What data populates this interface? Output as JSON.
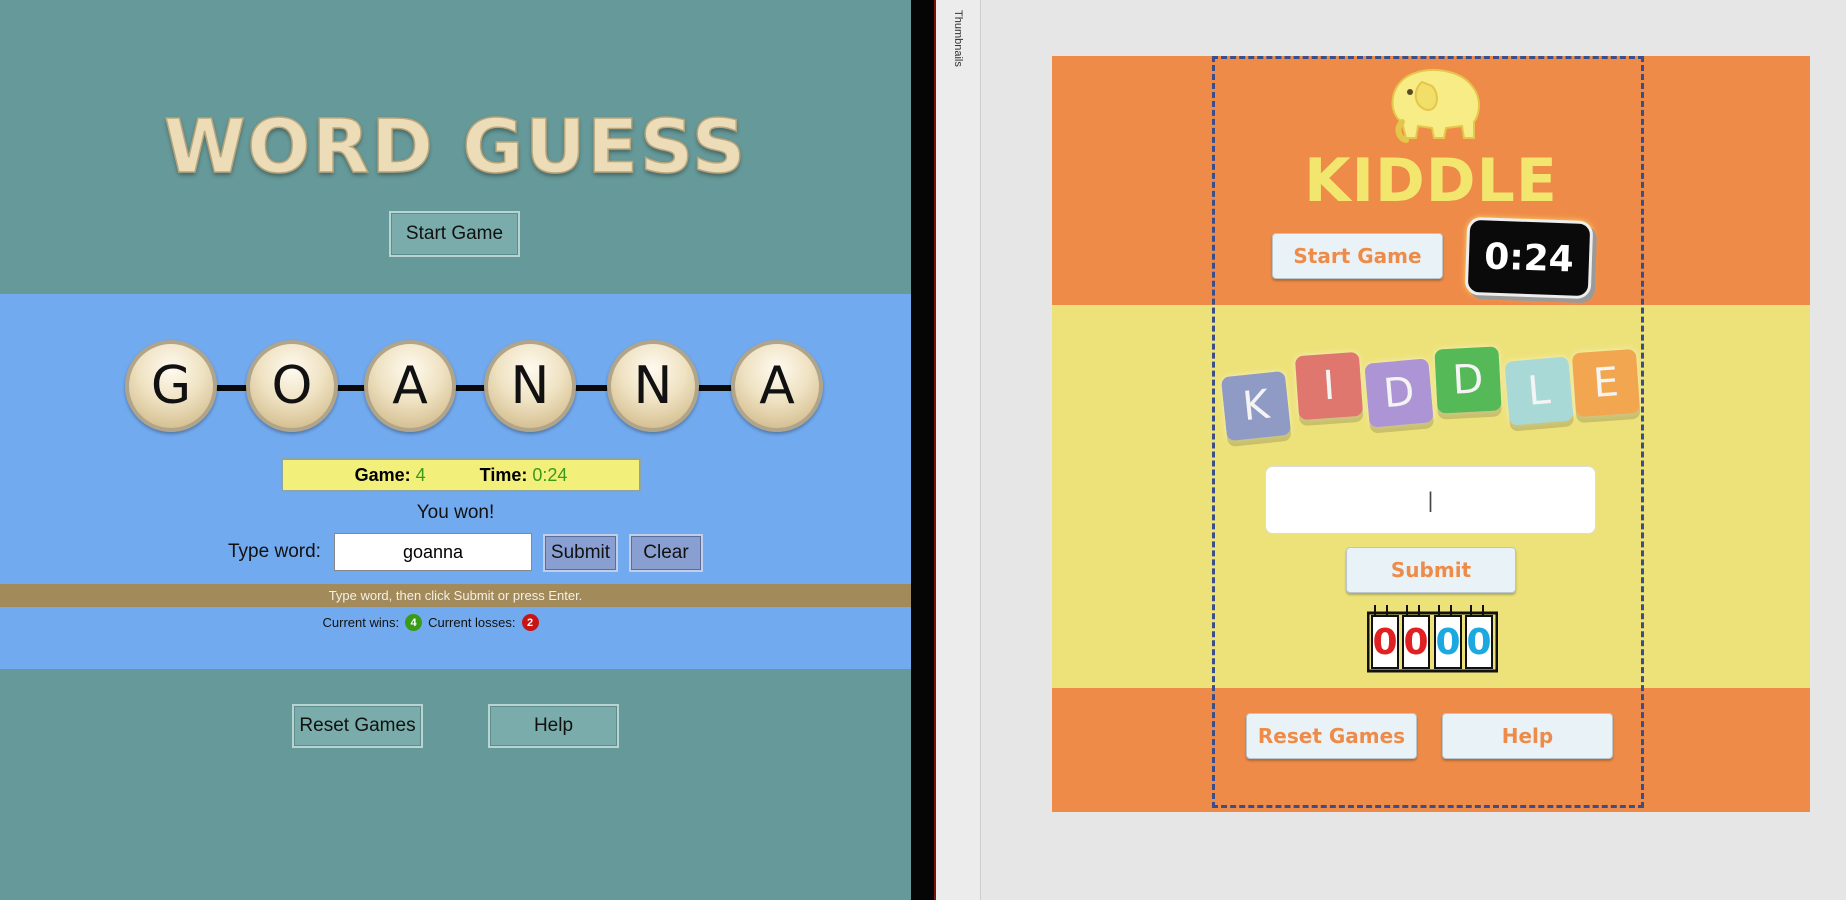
{
  "left": {
    "title": "WORD GUESS",
    "start_label": "Start Game",
    "letters": [
      "G",
      "O",
      "A",
      "N",
      "N",
      "A"
    ],
    "status": {
      "game_label": "Game:",
      "game_value": "4",
      "time_label": "Time:",
      "time_value": "0:24"
    },
    "result_text": "You won!",
    "type_label": "Type word:",
    "input_value": "goanna",
    "submit_label": "Submit",
    "clear_label": "Clear",
    "hint": "Type word, then click Submit or press Enter.",
    "wins_label": "Current wins:",
    "wins_value": "4",
    "losses_label": "Current losses:",
    "losses_value": "2",
    "reset_label": "Reset Games",
    "help_label": "Help"
  },
  "thumbnails_label": "Thumbnails",
  "right": {
    "logo_text": "KIDDLE",
    "start_label": "Start Game",
    "clock": "0:24",
    "tiles": [
      {
        "letter": "K",
        "color": "#8f9bc4"
      },
      {
        "letter": "I",
        "color": "#e0776e"
      },
      {
        "letter": "D",
        "color": "#ad94d4"
      },
      {
        "letter": "D",
        "color": "#55b957"
      },
      {
        "letter": "L",
        "color": "#a9d9d6"
      },
      {
        "letter": "E",
        "color": "#f1a64f"
      }
    ],
    "input_value": "|",
    "submit_label": "Submit",
    "counter_digits": [
      {
        "value": "0",
        "color": "#e12121"
      },
      {
        "value": "0",
        "color": "#e12121"
      },
      {
        "value": "0",
        "color": "#1ca9e0"
      },
      {
        "value": "0",
        "color": "#1ca9e0"
      }
    ],
    "reset_label": "Reset Games",
    "help_label": "Help"
  },
  "colors": {
    "left_bg": "#669999",
    "left_band": "#72aaef",
    "slide_orange": "#ef8b48",
    "slide_yellow": "#ede27a"
  }
}
